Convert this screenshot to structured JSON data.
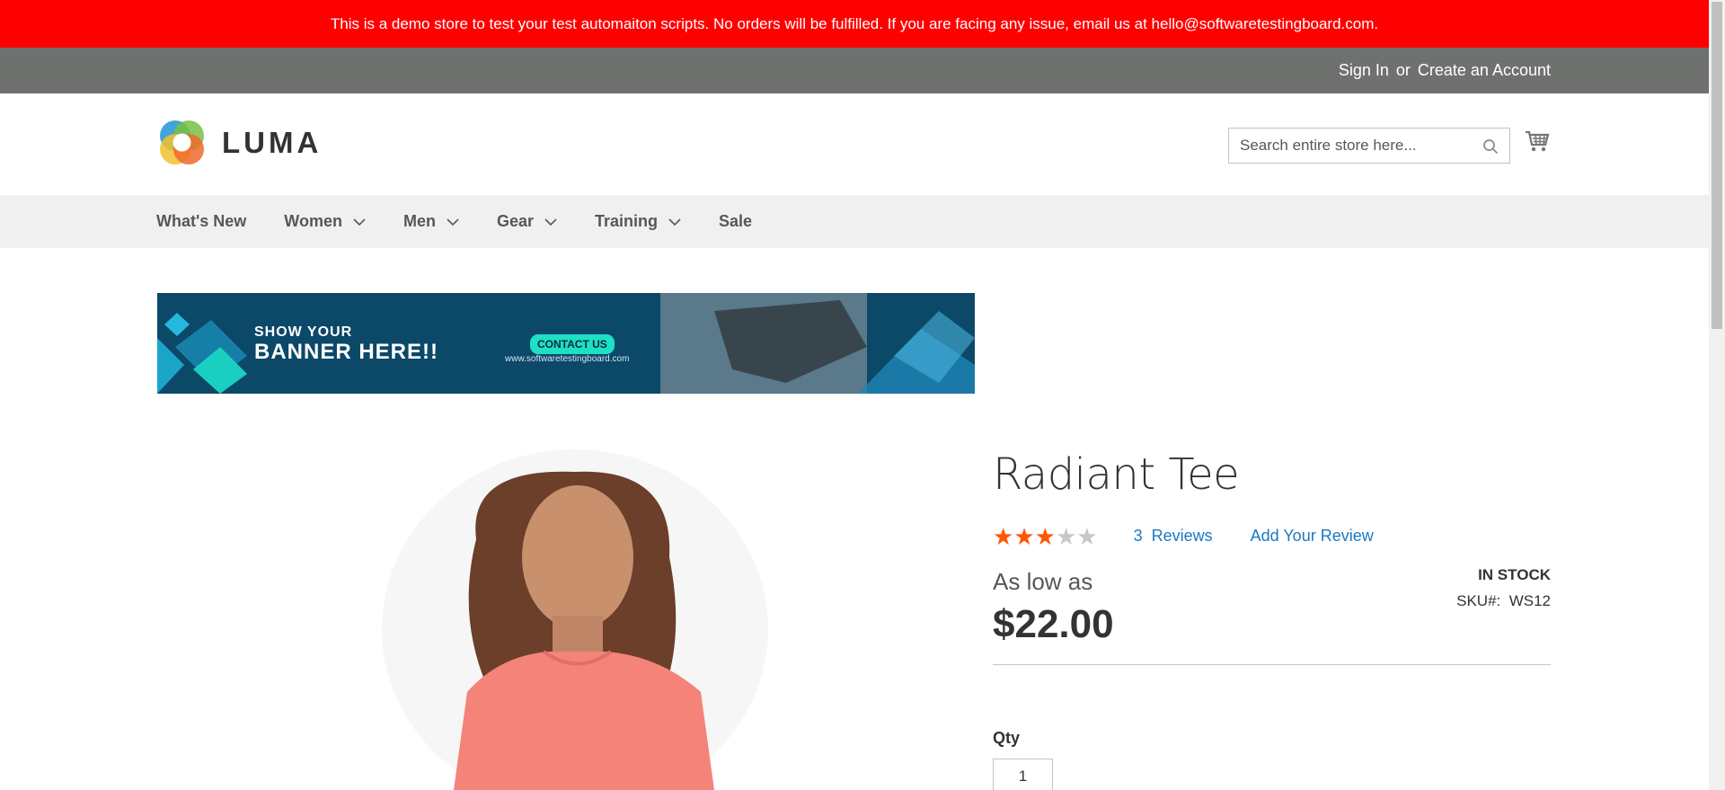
{
  "demo_notice": "This is a demo store to test your test automaiton scripts. No orders will be fulfilled. If you are facing any issue, email us at hello@softwaretestingboard.com.",
  "top_links": {
    "sign_in": "Sign In",
    "or": "or",
    "create_account": "Create an Account"
  },
  "logo": {
    "text": "LUMA"
  },
  "search": {
    "placeholder": "Search entire store here..."
  },
  "nav": {
    "items": [
      {
        "label": "What's New"
      },
      {
        "label": "Women"
      },
      {
        "label": "Men"
      },
      {
        "label": "Gear"
      },
      {
        "label": "Training"
      },
      {
        "label": "Sale"
      }
    ]
  },
  "banner": {
    "line1": "SHOW YOUR",
    "line2": "BANNER HERE!!",
    "button": "CONTACT US",
    "url": "www.softwaretestingboard.com"
  },
  "product": {
    "name": "Radiant Tee",
    "rating_stars": 3,
    "rating_max": 5,
    "reviews_count": "3",
    "reviews_label": "Reviews",
    "add_review": "Add Your Review",
    "price_prefix": "As low as",
    "price": "$22.00",
    "stock": "IN STOCK",
    "sku_label": "SKU#:",
    "sku": "WS12",
    "qty_label": "Qty",
    "qty_value": "1"
  },
  "colors": {
    "demo_bar": "#ff0000",
    "top_bar": "#6e716e",
    "nav_bg": "#f0f0f0",
    "link": "#1979c3",
    "star_filled": "#ff5501",
    "star_empty": "#c7c7c7"
  },
  "icons": [
    "search-icon",
    "cart-icon",
    "chevron-down-icon",
    "star-icon"
  ]
}
